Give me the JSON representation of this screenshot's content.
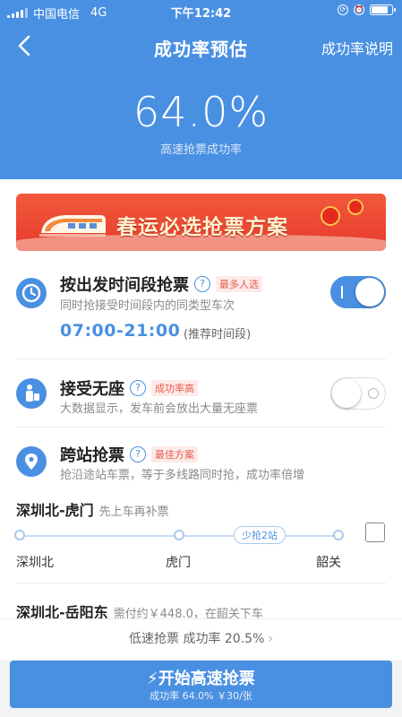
{
  "status_bar": {
    "carrier": "中国电信",
    "network": "4G",
    "time": "下午12:42"
  },
  "header": {
    "title": "成功率预估",
    "explain_link": "成功率说明",
    "rate": "64.0%",
    "rate_caption": "高速抢票成功率"
  },
  "banner": {
    "text": "春运必选抢票方案"
  },
  "options": [
    {
      "name": "按出发时间段抢票",
      "tag": "最多人选",
      "desc": "同时抢接受时间段内的同类型车次",
      "toggle_on": true,
      "time_range": "07:00-21:00",
      "time_note": "(推荐时间段)"
    },
    {
      "name": "接受无座",
      "tag": "成功率高",
      "desc": "大数据显示，发车前会放出大量无座票",
      "toggle_on": false
    },
    {
      "name": "跨站抢票",
      "tag": "最佳方案",
      "desc": "抢沿途站车票，等于多线路同时抢，成功率倍增"
    }
  ],
  "route1": {
    "name": "深圳北-虎门",
    "note": "先上车再补票",
    "stations": [
      "深圳北",
      "虎门",
      "韶关"
    ],
    "pill": "少抢2站"
  },
  "route2": {
    "name": "深圳北-岳阳东",
    "note": "需付约￥448.0，在韶关下车"
  },
  "footer": {
    "low_speed": "低速抢票 成功率 20.5%",
    "start_label": "开始高速抢票",
    "start_sub": "成功率 64.0% ￥30/张"
  },
  "colors": {
    "primary": "#4a90e2",
    "tag_red": "#e85a4f",
    "banner_red": "#e63a2c"
  },
  "battery_level": 0.85
}
